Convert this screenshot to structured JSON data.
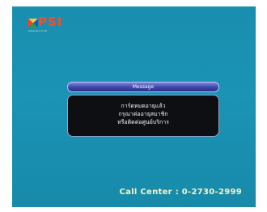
{
  "brand": {
    "logo_text": "PSI",
    "logo_url": "www.psi.co.th",
    "logo_color": "#ff4a22"
  },
  "dialog": {
    "title": "Message",
    "lines": [
      "การ์ดหมดอายุแล้ว",
      "กรุณาต่ออายุสมาชิก",
      "หรือติดต่อศูนย์บริการ"
    ],
    "title_bar_color": "#3c44a8",
    "body_color": "#0d0f12"
  },
  "footer": {
    "call_center": "Call Center : 0-2730-2999"
  },
  "screen": {
    "background_color": "#1a8eaf"
  }
}
